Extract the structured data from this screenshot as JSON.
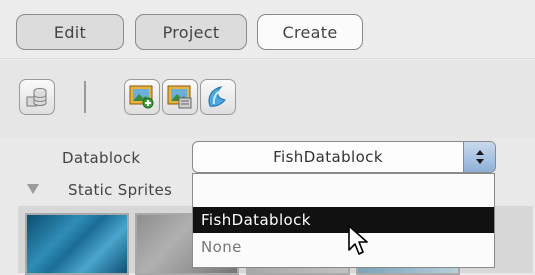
{
  "menu": {
    "edit_label": "Edit",
    "project_label": "Project",
    "create_label": "Create"
  },
  "toolbar": {
    "icons": [
      "database-icon",
      "add-image-icon",
      "image-library-icon",
      "wave-shape-icon"
    ]
  },
  "datablock": {
    "label": "Datablock",
    "selected_value": "FishDatablock",
    "options": [
      "",
      "FishDatablock",
      "None"
    ],
    "highlighted_index": 1
  },
  "section": {
    "title": "Static Sprites"
  },
  "colors": {
    "selection_bg": "#111111",
    "stepper_blue": "#8fb0d8"
  }
}
